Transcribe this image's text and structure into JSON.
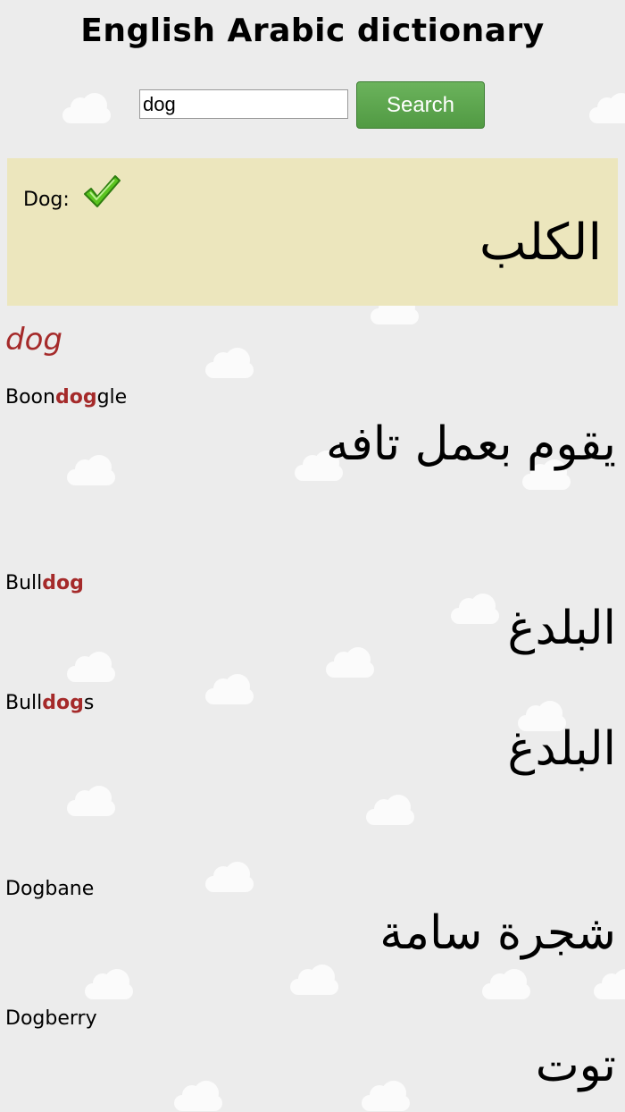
{
  "header": {
    "title": "English Arabic dictionary"
  },
  "search": {
    "value": "dog",
    "button_label": "Search"
  },
  "result": {
    "label": "Dog:",
    "arabic": "الكلب"
  },
  "query_heading": "dog",
  "entries": [
    {
      "pre": "Boon",
      "match": "dog",
      "post": "gle",
      "arabic": "يقوم بعمل تافه"
    },
    {
      "pre": "Bull",
      "match": "dog",
      "post": "",
      "arabic": "البلدغ"
    },
    {
      "pre": "Bull",
      "match": "dog",
      "post": "s",
      "arabic": "البلدغ"
    },
    {
      "pre": "Dogbane",
      "match": "",
      "post": "",
      "arabic": "شجرة سامة"
    },
    {
      "pre": "Dogberry",
      "match": "",
      "post": "",
      "arabic": "توت"
    }
  ]
}
